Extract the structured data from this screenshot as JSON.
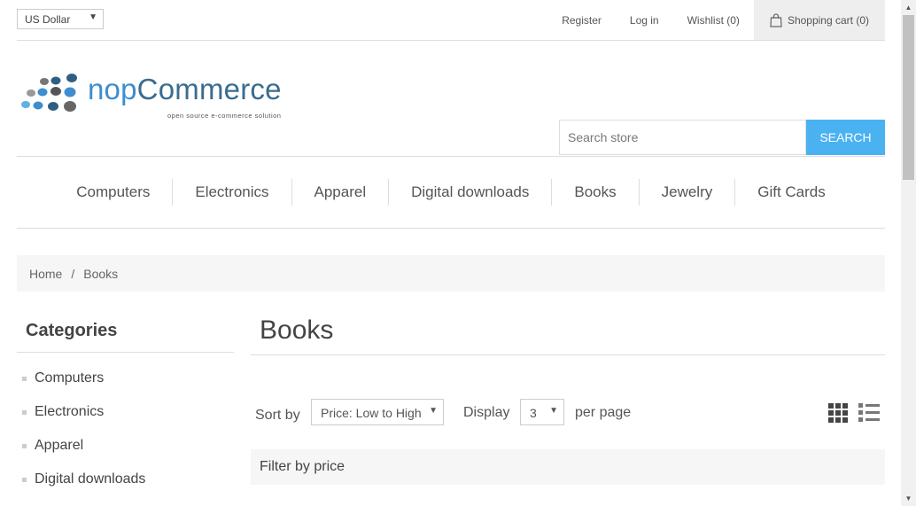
{
  "header": {
    "currency": "US Dollar",
    "links": {
      "register": "Register",
      "login": "Log in",
      "wishlist": "Wishlist (0)",
      "cart": "Shopping cart (0)"
    }
  },
  "logo": {
    "brand_prefix": "nop",
    "brand_suffix": "Commerce",
    "tagline": "open source e-commerce solution"
  },
  "search": {
    "placeholder": "Search store",
    "button": "SEARCH"
  },
  "menu": [
    "Computers",
    "Electronics",
    "Apparel",
    "Digital downloads",
    "Books",
    "Jewelry",
    "Gift Cards"
  ],
  "breadcrumb": {
    "home": "Home",
    "separator": "/",
    "current": "Books"
  },
  "sidebar": {
    "title": "Categories",
    "items": [
      "Computers",
      "Electronics",
      "Apparel",
      "Digital downloads"
    ]
  },
  "main": {
    "title": "Books",
    "sort_label": "Sort by",
    "sort_value": "Price: Low to High",
    "display_label": "Display",
    "display_value": "3",
    "per_page_label": "per page",
    "filter_title": "Filter by price"
  },
  "colors": {
    "accent": "#4ab2f1",
    "logo_blue": "#3d8dcf"
  }
}
